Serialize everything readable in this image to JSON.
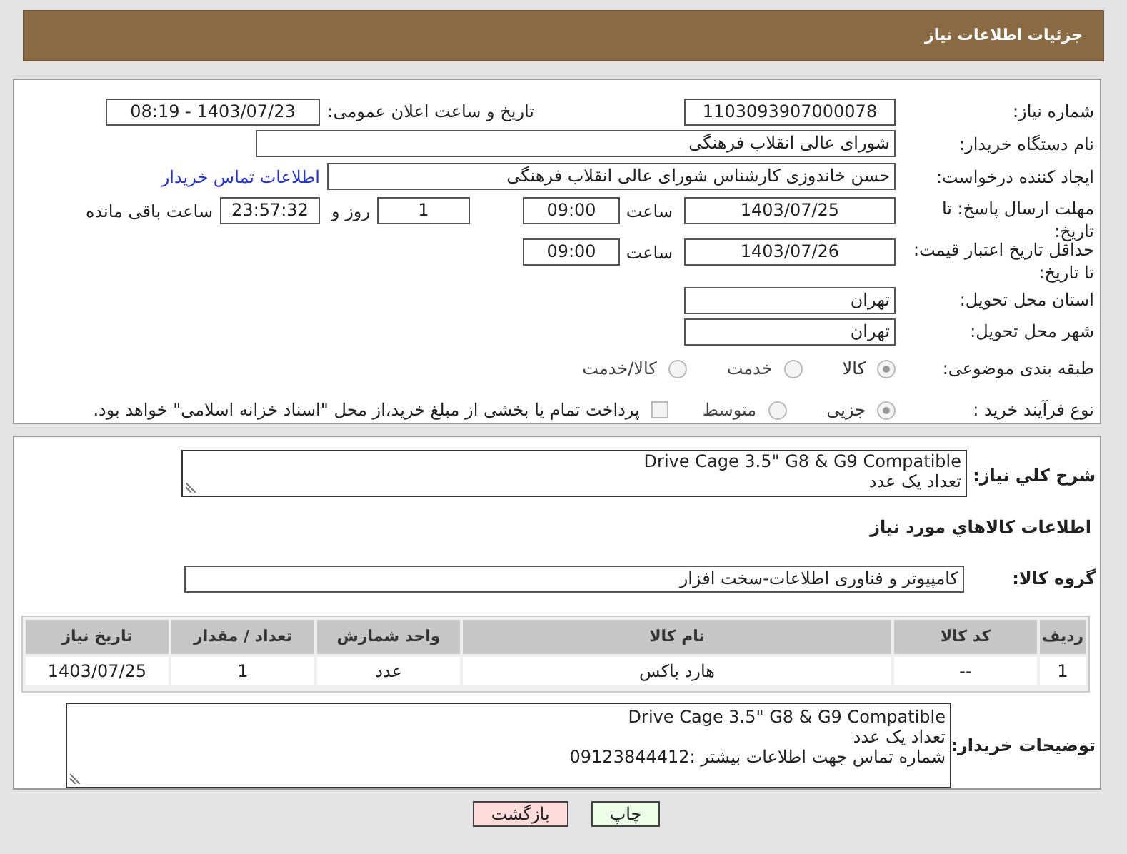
{
  "header": {
    "title": "جزئیات اطلاعات نیاز"
  },
  "need_number": {
    "label": "شماره نیاز:",
    "value": "1103093907000078"
  },
  "announce_datetime": {
    "label": "تاریخ و ساعت اعلان عمومی:",
    "value": "1403/07/23 - 08:19"
  },
  "buyer_org": {
    "label": "نام دستگاه خریدار:",
    "value": "شورای عالی انقلاب فرهنگی"
  },
  "requester": {
    "label": "ایجاد کننده درخواست:",
    "value": "حسن خاندوزی کارشناس شورای عالی انقلاب فرهنگی",
    "link": "اطلاعات تماس خریدار"
  },
  "reply_deadline": {
    "label": "مهلت ارسال پاسخ: تا تاریخ:",
    "date": "1403/07/25",
    "time_label": "ساعت",
    "time": "09:00",
    "days": "1",
    "days_label": "روز و",
    "remaining": "23:57:32",
    "remaining_label": "ساعت باقی مانده"
  },
  "price_validity": {
    "label": "حداقل تاریخ اعتبار قیمت: تا تاریخ:",
    "date": "1403/07/26",
    "time_label": "ساعت",
    "time": "09:00"
  },
  "province": {
    "label": "استان محل تحویل:",
    "value": "تهران"
  },
  "city": {
    "label": "شهر محل تحویل:",
    "value": "تهران"
  },
  "category": {
    "label": "طبقه بندی موضوعی:",
    "options": [
      {
        "label": "کالا",
        "selected": true
      },
      {
        "label": "خدمت",
        "selected": false
      },
      {
        "label": "کالا/خدمت",
        "selected": false
      }
    ]
  },
  "purchase_type": {
    "label": "نوع فرآیند خرید :",
    "options": [
      {
        "label": "جزیی",
        "selected": true
      },
      {
        "label": "متوسط",
        "selected": false
      }
    ],
    "treasury": {
      "label": "پرداخت تمام یا بخشی از مبلغ خرید،از محل \"اسناد خزانه اسلامی\" خواهد بود.",
      "checked": false
    }
  },
  "summary": {
    "label": "شرح کلي نياز:",
    "lines": [
      "Drive Cage 3.5\" G8 & G9 Compatible",
      "تعداد یک عدد"
    ]
  },
  "goods_heading": "اطلاعات کالاهاي مورد نياز",
  "goods_group": {
    "label": "گروه کالا:",
    "value": "کامپیوتر و فناوری اطلاعات-سخت افزار"
  },
  "table": {
    "columns": [
      "ردیف",
      "کد کالا",
      "نام کالا",
      "واحد شمارش",
      "تعداد / مقدار",
      "تاریخ نیاز"
    ],
    "rows": [
      [
        "1",
        "--",
        "هارد باکس",
        "عدد",
        "1",
        "1403/07/25"
      ]
    ]
  },
  "buyer_notes": {
    "label": "توضیحات خریدار:",
    "lines": [
      "Drive Cage 3.5\" G8 & G9 Compatible",
      "تعداد یک عدد",
      "شماره تماس جهت اطلاعات بیشتر :09123844412"
    ]
  },
  "buttons": [
    {
      "label": "چاپ",
      "kind": "print"
    },
    {
      "label": "بازگشت",
      "kind": "back"
    }
  ]
}
